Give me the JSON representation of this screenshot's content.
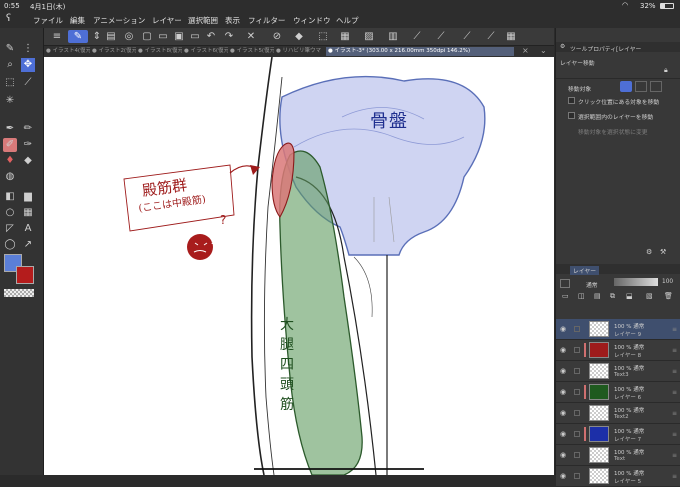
{
  "status_bar": {
    "time": "0:55",
    "date": "4月1日(木)",
    "battery": "32%",
    "wifi_icon": "wifi-icon",
    "battery_icon": "battery-icon"
  },
  "menu": {
    "logo_icon": "clip-studio-logo-icon",
    "items": [
      "ファイル",
      "編集",
      "アニメーション",
      "レイヤー",
      "選択範囲",
      "表示",
      "フィルター",
      "ウィンドウ",
      "ヘルプ"
    ]
  },
  "tabs": [
    "● イラスト4(復元",
    "● イラスト2(復元",
    "● イラスト8(復元",
    "● イラスト6(復元",
    "● イラスト5(復元",
    "● リハビリ筆ウマ",
    "● イラスト-3* (303.00 x 216.00mm 350dpi 146.2%)"
  ],
  "tool_property": {
    "header": "ツールプロパティ[レイヤー",
    "tool_name": "レイヤー移動",
    "target_label": "移動対象",
    "options": [
      "クリック位置にある対象を移動",
      "選択範囲内のレイヤーを移動",
      "移動対象を選択状態に変更"
    ]
  },
  "layer_panel": {
    "tab_label": "レイヤー",
    "blend_mode": "通常",
    "opacity_value": "100",
    "layers": [
      {
        "pct": "100 % 通常",
        "name": "レイヤー 9",
        "thumb": "checker",
        "selected": true,
        "color_bar": false
      },
      {
        "pct": "100 % 通常",
        "name": "レイヤー 8",
        "thumb": "#9e1b1b",
        "selected": false,
        "color_bar": true
      },
      {
        "pct": "100 % 通常",
        "name": "Text3",
        "thumb": "checker",
        "selected": false,
        "color_bar": false
      },
      {
        "pct": "100 % 通常",
        "name": "レイヤー 6",
        "thumb": "#1f5a1f",
        "selected": false,
        "color_bar": true
      },
      {
        "pct": "100 % 通常",
        "name": "Text2",
        "thumb": "checker",
        "selected": false,
        "color_bar": false
      },
      {
        "pct": "100 % 通常",
        "name": "レイヤー 7",
        "thumb": "#1c2fa8",
        "selected": false,
        "color_bar": true
      },
      {
        "pct": "100 % 通常",
        "name": "Text",
        "thumb": "checker",
        "selected": false,
        "color_bar": false
      },
      {
        "pct": "100 % 通常",
        "name": "レイヤー 5",
        "thumb": "checker",
        "selected": false,
        "color_bar": false
      }
    ]
  },
  "canvas_text": {
    "pelvis_label": "骨盤",
    "hip_muscle_label": "殿筋群",
    "hip_muscle_note": "(ここは中殿筋)",
    "quad_label": "大腿四頭筋",
    "question_mark": "?",
    "question_mark_2": "?"
  },
  "colors": {
    "main_color": "#5b7fd8",
    "sub_color": "#b41c1c",
    "accent": "#4a6fd0"
  }
}
